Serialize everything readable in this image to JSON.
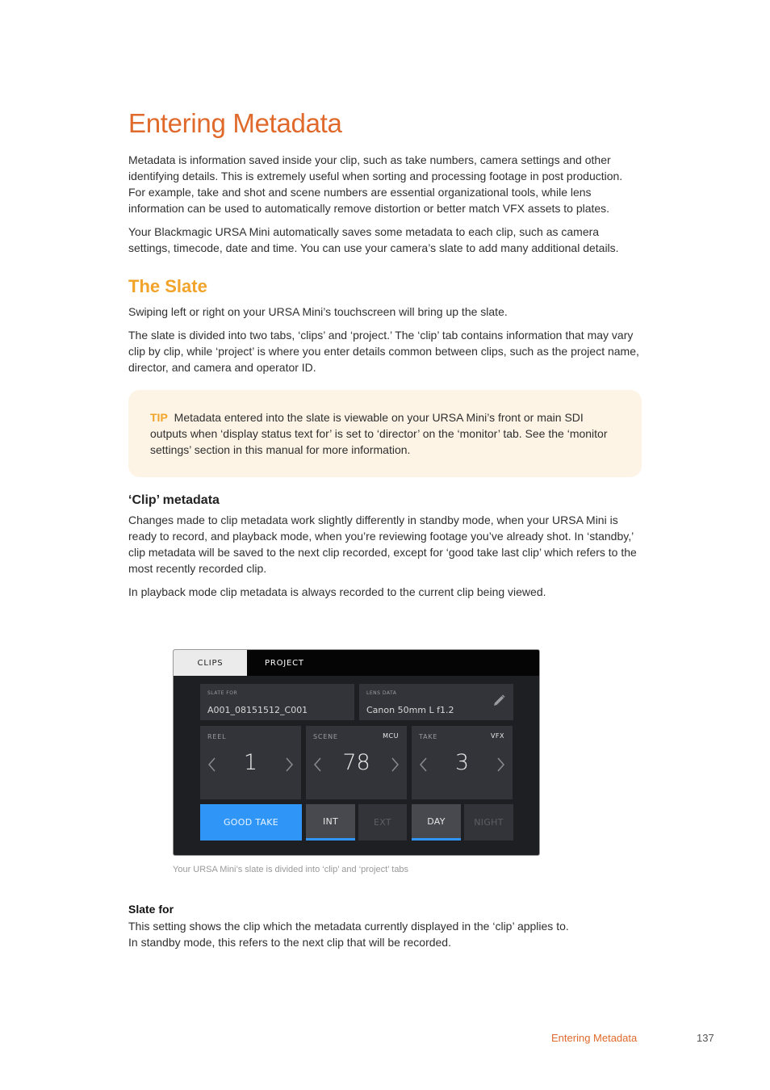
{
  "page": {
    "title": "Entering Metadata",
    "intro_paragraphs": [
      "Metadata is information saved inside your clip, such as take numbers, camera settings and other identifying details. This is extremely useful when sorting and processing footage in post production. For example, take and shot and scene numbers are essential organizational tools, while lens information can be used to automatically remove distortion or better match VFX assets to plates.",
      "Your Blackmagic URSA Mini automatically saves some metadata to each clip, such as camera settings, timecode, date and time. You can use your camera’s slate to add many additional details."
    ],
    "slate_section": {
      "heading": "The Slate",
      "paragraphs": [
        "Swiping left or right on your URSA Mini’s touchscreen will bring up the slate.",
        "The slate is divided into two tabs, ‘clips’ and ‘project.’ The ‘clip’ tab contains information that may vary clip by clip, while ‘project’ is where you enter details common between clips, such as the project name, director, and camera and operator ID."
      ],
      "tip": {
        "label": "TIP",
        "text": "Metadata entered into the slate is viewable on your URSA Mini’s front or main SDI outputs when ‘display status text for’ is set to ‘director’ on the ‘monitor’ tab. See the ‘monitor settings’ section in this manual for more information."
      }
    },
    "clip_metadata": {
      "heading": "‘Clip’ metadata",
      "paragraphs": [
        "Changes made to clip metadata work slightly differently in standby mode, when your URSA Mini is ready to record, and playback mode, when you’re reviewing footage you’ve already shot. In ‘standby,’ clip metadata will be saved to the next clip recorded, except for ‘good take last clip’ which refers to the most recently recorded clip.",
        "In playback mode clip metadata is always recorded to the current clip being viewed."
      ]
    },
    "slate_ui": {
      "tabs": [
        {
          "label": "CLIPS",
          "active": true
        },
        {
          "label": "PROJECT",
          "active": false
        }
      ],
      "slate_for": {
        "label": "SLATE FOR",
        "value": "A001_08151512_C001"
      },
      "lens_data": {
        "label": "LENS DATA",
        "value": "Canon 50mm L f1.2",
        "icon": "pencil-icon"
      },
      "counters": [
        {
          "label": "REEL",
          "tag": "",
          "value": "1"
        },
        {
          "label": "SCENE",
          "tag": "MCU",
          "value": "78"
        },
        {
          "label": "TAKE",
          "tag": "VFX",
          "value": "3"
        }
      ],
      "buttons": {
        "good_take": "GOOD TAKE",
        "int": "INT",
        "ext": "EXT",
        "day": "DAY",
        "night": "NIGHT"
      },
      "selected": {
        "int_ext": "INT",
        "day_night": "DAY"
      },
      "colors": {
        "accent_blue": "#2f96f7",
        "panel_bg": "#1e1f23",
        "field_bg": "#33343a"
      }
    },
    "caption": "Your URSA Mini’s slate is divided into ‘clip’ and ‘project’ tabs",
    "slate_for_section": {
      "heading": "Slate for",
      "lines": [
        "This setting shows the clip which the metadata currently displayed in the ‘clip’ applies to.",
        "In standby mode, this refers to the next clip that will be recorded."
      ]
    },
    "footer": {
      "section_title": "Entering Metadata",
      "page_number": "137"
    },
    "colors": {
      "title_orange": "#e06a2c",
      "heading_amber": "#f1a32a",
      "tip_bg": "#fdf4e6"
    }
  }
}
